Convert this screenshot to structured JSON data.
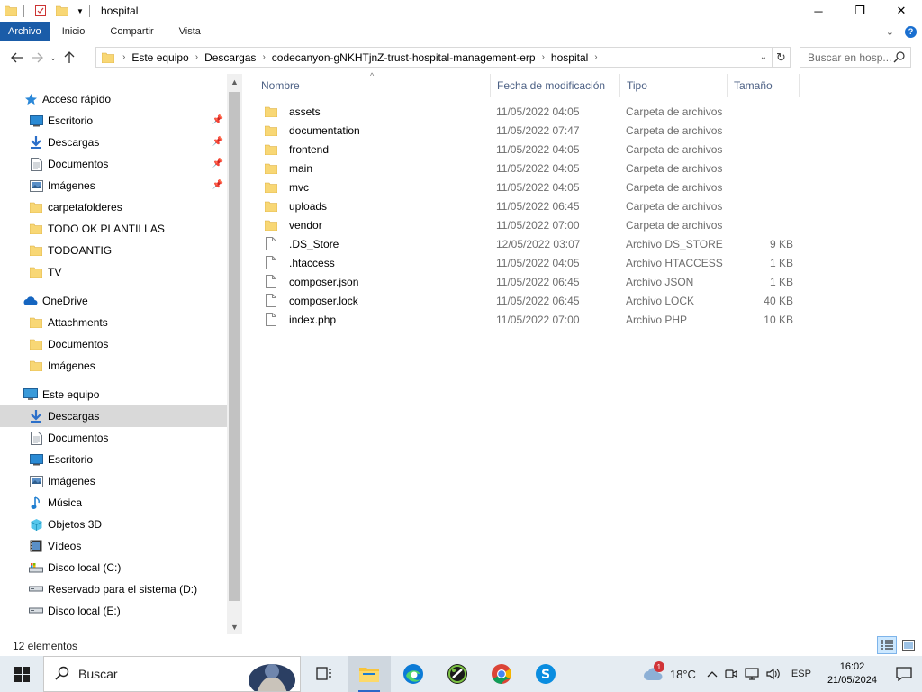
{
  "window": {
    "title": "hospital",
    "controls": {
      "minimize": "─",
      "maximize": "❐",
      "close": "✕"
    }
  },
  "ribbon": {
    "tabs": [
      {
        "label": "Archivo",
        "active": true
      },
      {
        "label": "Inicio"
      },
      {
        "label": "Compartir"
      },
      {
        "label": "Vista"
      }
    ]
  },
  "address": {
    "breadcrumbs": [
      "Este equipo",
      "Descargas",
      "codecanyon-gNKHTjnZ-trust-hospital-management-erp",
      "hospital"
    ],
    "search_placeholder": "Buscar en hosp..."
  },
  "nav": {
    "quick_access": {
      "label": "Acceso rápido",
      "items": [
        {
          "label": "Escritorio",
          "icon": "desktop-icon",
          "pinned": true
        },
        {
          "label": "Descargas",
          "icon": "download-icon",
          "pinned": true
        },
        {
          "label": "Documentos",
          "icon": "document-icon",
          "pinned": true
        },
        {
          "label": "Imágenes",
          "icon": "image-icon",
          "pinned": true
        },
        {
          "label": "carpetafolderes",
          "icon": "folder-icon"
        },
        {
          "label": "TODO OK PLANTILLAS",
          "icon": "folder-icon"
        },
        {
          "label": "TODOANTIG",
          "icon": "folder-icon"
        },
        {
          "label": "TV",
          "icon": "folder-icon"
        }
      ]
    },
    "onedrive": {
      "label": "OneDrive",
      "items": [
        {
          "label": "Attachments",
          "icon": "folder-icon"
        },
        {
          "label": "Documentos",
          "icon": "folder-icon"
        },
        {
          "label": "Imágenes",
          "icon": "folder-icon"
        }
      ]
    },
    "this_pc": {
      "label": "Este equipo",
      "items": [
        {
          "label": "Descargas",
          "icon": "download-icon",
          "selected": true
        },
        {
          "label": "Documentos",
          "icon": "document-icon"
        },
        {
          "label": "Escritorio",
          "icon": "desktop-icon"
        },
        {
          "label": "Imágenes",
          "icon": "image-icon"
        },
        {
          "label": "Música",
          "icon": "music-icon"
        },
        {
          "label": "Objetos 3D",
          "icon": "cube-icon"
        },
        {
          "label": "Vídeos",
          "icon": "video-icon"
        },
        {
          "label": "Disco local (C:)",
          "icon": "drive-c-icon"
        },
        {
          "label": "Reservado para el sistema (D:)",
          "icon": "drive-icon"
        },
        {
          "label": "Disco local (E:)",
          "icon": "drive-icon"
        }
      ]
    }
  },
  "columns": {
    "name": "Nombre",
    "date": "Fecha de modificación",
    "type": "Tipo",
    "size": "Tamaño"
  },
  "files": [
    {
      "name": "assets",
      "date": "11/05/2022 04:05",
      "type": "Carpeta de archivos",
      "size": "",
      "icon": "folder-icon"
    },
    {
      "name": "documentation",
      "date": "11/05/2022 07:47",
      "type": "Carpeta de archivos",
      "size": "",
      "icon": "folder-icon"
    },
    {
      "name": "frontend",
      "date": "11/05/2022 04:05",
      "type": "Carpeta de archivos",
      "size": "",
      "icon": "folder-icon"
    },
    {
      "name": "main",
      "date": "11/05/2022 04:05",
      "type": "Carpeta de archivos",
      "size": "",
      "icon": "folder-icon"
    },
    {
      "name": "mvc",
      "date": "11/05/2022 04:05",
      "type": "Carpeta de archivos",
      "size": "",
      "icon": "folder-icon"
    },
    {
      "name": "uploads",
      "date": "11/05/2022 06:45",
      "type": "Carpeta de archivos",
      "size": "",
      "icon": "folder-icon"
    },
    {
      "name": "vendor",
      "date": "11/05/2022 07:00",
      "type": "Carpeta de archivos",
      "size": "",
      "icon": "folder-icon"
    },
    {
      "name": ".DS_Store",
      "date": "12/05/2022 03:07",
      "type": "Archivo DS_STORE",
      "size": "9 KB",
      "icon": "file-icon"
    },
    {
      "name": ".htaccess",
      "date": "11/05/2022 04:05",
      "type": "Archivo HTACCESS",
      "size": "1 KB",
      "icon": "file-icon"
    },
    {
      "name": "composer.json",
      "date": "11/05/2022 06:45",
      "type": "Archivo JSON",
      "size": "1 KB",
      "icon": "file-icon"
    },
    {
      "name": "composer.lock",
      "date": "11/05/2022 06:45",
      "type": "Archivo LOCK",
      "size": "40 KB",
      "icon": "file-icon"
    },
    {
      "name": "index.php",
      "date": "11/05/2022 07:00",
      "type": "Archivo PHP",
      "size": "10 KB",
      "icon": "file-icon"
    }
  ],
  "status": {
    "count": "12 elementos"
  },
  "taskbar": {
    "search_label": "Buscar",
    "apps": [
      {
        "name": "task-view-icon"
      },
      {
        "name": "file-explorer-icon",
        "active": true
      },
      {
        "name": "edge-icon"
      },
      {
        "name": "app-green-icon"
      },
      {
        "name": "chrome-icon"
      },
      {
        "name": "skype-icon"
      }
    ],
    "weather": {
      "temp": "18°C",
      "badge": "1"
    },
    "language": "ESP",
    "time": "16:02",
    "date": "21/05/2024"
  },
  "colors": {
    "accent": "#1a5ca8",
    "folder": "#f8d775",
    "selection": "#d9d9d9",
    "header_text": "#4d6185"
  }
}
